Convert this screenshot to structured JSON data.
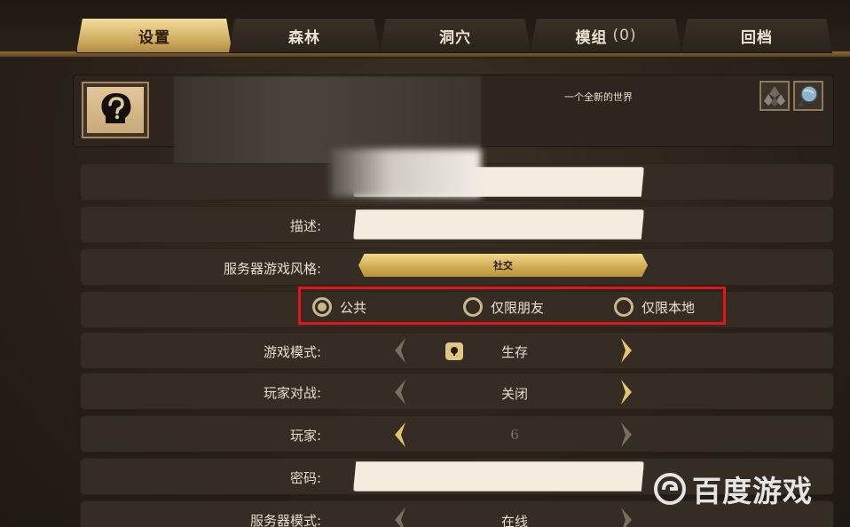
{
  "tabs": [
    {
      "label": "设置",
      "active": true
    },
    {
      "label": "森林",
      "active": false
    },
    {
      "label": "洞穴",
      "active": false
    },
    {
      "label": "模组",
      "count": "(0)",
      "active": false
    },
    {
      "label": "回档",
      "active": false
    }
  ],
  "world": {
    "subtitle": "一个全新的世界",
    "icon": "question-mark-portrait-icon",
    "corner_icons": [
      "crystal-cluster-icon",
      "globe-icon"
    ]
  },
  "form": {
    "name_value": "",
    "description_label": "描述:",
    "description_value": "",
    "server_style_label": "服务器游戏风格:",
    "server_style_value": "社交",
    "visibility": {
      "options": [
        "公共",
        "仅限朋友",
        "仅限本地"
      ],
      "selected": "公共"
    },
    "game_mode_label": "游戏模式:",
    "game_mode_value": "生存",
    "pvp_label": "玩家对战:",
    "pvp_value": "关闭",
    "players_label": "玩家:",
    "players_value": "6",
    "password_label": "密码:",
    "password_value": "",
    "server_mode_label": "服务器模式:",
    "server_mode_value": "在线"
  },
  "watermark": {
    "text": "百度游戏"
  },
  "colors": {
    "accent_gold": "#d2b064",
    "highlight_red": "#e3141c",
    "input_bg": "#f3ecdf"
  }
}
